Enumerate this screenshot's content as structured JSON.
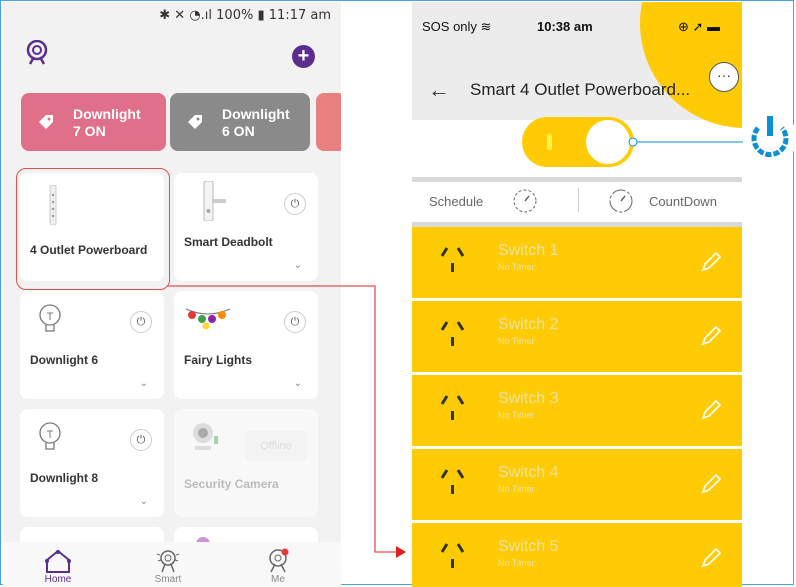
{
  "left_app": {
    "status_bar": "100%",
    "status_time": "11:17 am",
    "scenes": [
      {
        "line1": "Downlight",
        "line2": "7 ON",
        "color": "#e0708a"
      },
      {
        "line1": "Downlight",
        "line2": "6 ON",
        "color": "#8a8a8a"
      }
    ],
    "devices": [
      {
        "name": "4 Outlet Powerboard"
      },
      {
        "name": "Smart Deadbolt"
      },
      {
        "name": "Downlight 6"
      },
      {
        "name": "Fairy Lights"
      },
      {
        "name": "Downlight 8"
      },
      {
        "name": "Security Camera",
        "status": "Offline"
      }
    ],
    "nav": [
      {
        "label": "Home"
      },
      {
        "label": "Smart"
      },
      {
        "label": "Me"
      }
    ]
  },
  "right_app": {
    "status_left": "SOS only",
    "status_time": "10:38 am",
    "title": "Smart 4 Outlet Powerboard...",
    "schedule_label": "Schedule",
    "countdown_label": "CountDown",
    "switches": [
      {
        "name": "Switch 1",
        "timer": "No Timer"
      },
      {
        "name": "Switch 2",
        "timer": "No Timer"
      },
      {
        "name": "Switch 3",
        "timer": "No Timer"
      },
      {
        "name": "Switch 4",
        "timer": "No Timer"
      },
      {
        "name": "Switch 5",
        "timer": "No Timer"
      }
    ],
    "accent": "#ffcb05"
  }
}
